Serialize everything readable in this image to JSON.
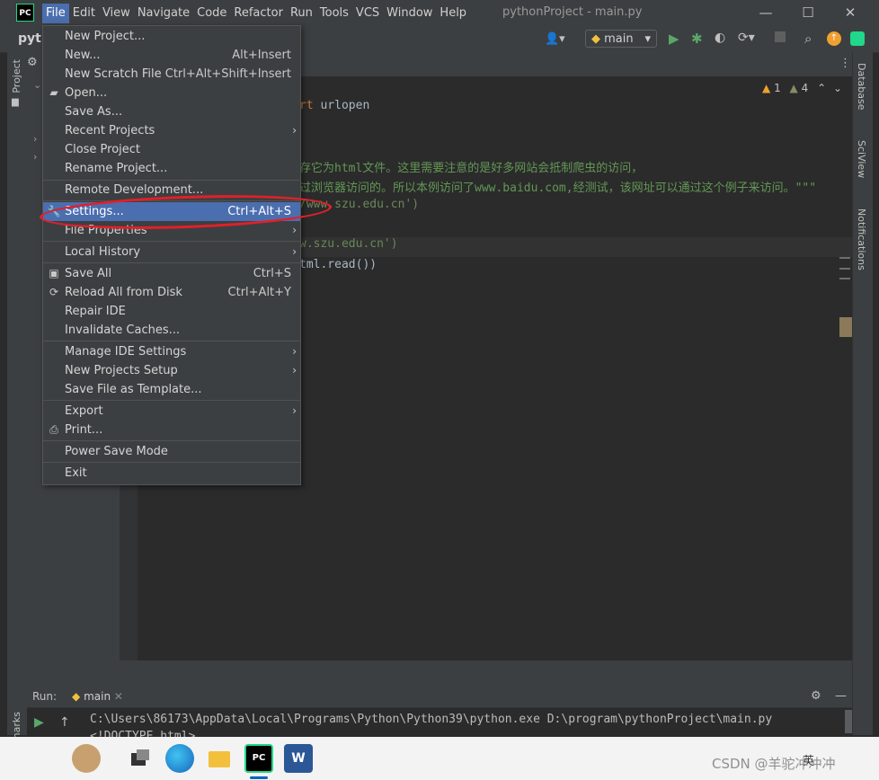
{
  "window": {
    "app_icon": "PC",
    "title": "pythonProject - main.py",
    "minimize": "—",
    "maximize": "☐",
    "close": "✕"
  },
  "menubar": [
    "File",
    "Edit",
    "View",
    "Navigate",
    "Code",
    "Refactor",
    "Run",
    "Tools",
    "VCS",
    "Window",
    "Help"
  ],
  "toolbar": {
    "project": "pyth",
    "run_config": "main"
  },
  "left_tool_window": "Project",
  "right_tools": [
    "Database",
    "SciView",
    "Notifications"
  ],
  "inspections": {
    "warnings": "1",
    "weak": "4"
  },
  "code_lines": [
    {
      "text": "rt urlopen",
      "kw": "rt",
      "rest": " urlopen"
    },
    {
      "text": "存它为html文件。这里需要注意的是好多网站会抵制爬虫的访问，"
    },
    {
      "text": "过浏览器访问的。所以本例访问了www.baidu.com,经测试，该网址可以通过这个例子来访问。\"\"\""
    },
    {
      "text": "/www.szu.edu.cn')"
    },
    {
      "text": "w.szu.edu.cn')"
    },
    {
      "text": "tml.read())"
    }
  ],
  "file_menu": {
    "items": [
      {
        "label": "New Project...",
        "shortcut": "",
        "icon": "",
        "arrow": false
      },
      {
        "label": "New...",
        "shortcut": "Alt+Insert",
        "icon": "",
        "arrow": false
      },
      {
        "label": "New Scratch File",
        "shortcut": "Ctrl+Alt+Shift+Insert",
        "icon": "",
        "arrow": false
      },
      {
        "label": "Open...",
        "shortcut": "",
        "icon": "folder-icon",
        "arrow": false
      },
      {
        "label": "Save As...",
        "shortcut": "",
        "icon": "",
        "arrow": false
      },
      {
        "label": "Recent Projects",
        "shortcut": "",
        "icon": "",
        "arrow": true
      },
      {
        "label": "Close Project",
        "shortcut": "",
        "icon": "",
        "arrow": false
      },
      {
        "label": "Rename Project...",
        "shortcut": "",
        "icon": "",
        "arrow": false
      },
      {
        "label": "Remote Development...",
        "shortcut": "",
        "icon": "",
        "arrow": false
      },
      {
        "label": "Settings...",
        "shortcut": "Ctrl+Alt+S",
        "icon": "wrench-icon",
        "arrow": false
      },
      {
        "label": "File Properties",
        "shortcut": "",
        "icon": "",
        "arrow": true
      },
      {
        "label": "Local History",
        "shortcut": "",
        "icon": "",
        "arrow": true
      },
      {
        "label": "Save All",
        "shortcut": "Ctrl+S",
        "icon": "save-icon",
        "arrow": false
      },
      {
        "label": "Reload All from Disk",
        "shortcut": "Ctrl+Alt+Y",
        "icon": "reload-icon",
        "arrow": false
      },
      {
        "label": "Repair IDE",
        "shortcut": "",
        "icon": "",
        "arrow": false
      },
      {
        "label": "Invalidate Caches...",
        "shortcut": "",
        "icon": "",
        "arrow": false
      },
      {
        "label": "Manage IDE Settings",
        "shortcut": "",
        "icon": "",
        "arrow": true
      },
      {
        "label": "New Projects Setup",
        "shortcut": "",
        "icon": "",
        "arrow": true
      },
      {
        "label": "Save File as Template...",
        "shortcut": "",
        "icon": "",
        "arrow": false
      },
      {
        "label": "Export",
        "shortcut": "",
        "icon": "",
        "arrow": true
      },
      {
        "label": "Print...",
        "shortcut": "",
        "icon": "printer-icon",
        "arrow": false
      },
      {
        "label": "Power Save Mode",
        "shortcut": "",
        "icon": "",
        "arrow": false
      },
      {
        "label": "Exit",
        "shortcut": "",
        "icon": "",
        "arrow": false
      }
    ],
    "selected": "Settings..."
  },
  "run_panel": {
    "label": "Run:",
    "tab": "main",
    "output_line1": "C:\\Users\\86173\\AppData\\Local\\Programs\\Python\\Python39\\python.exe D:\\program\\pythonProject\\main.py",
    "output_line2": "<!DOCTYPE html>"
  },
  "taskbar": {
    "lang": "英",
    "watermark": "CSDN @羊驼冲冲冲"
  },
  "colors": {
    "accent": "#4b6eaf",
    "annotation_circle": "#e0202a"
  }
}
